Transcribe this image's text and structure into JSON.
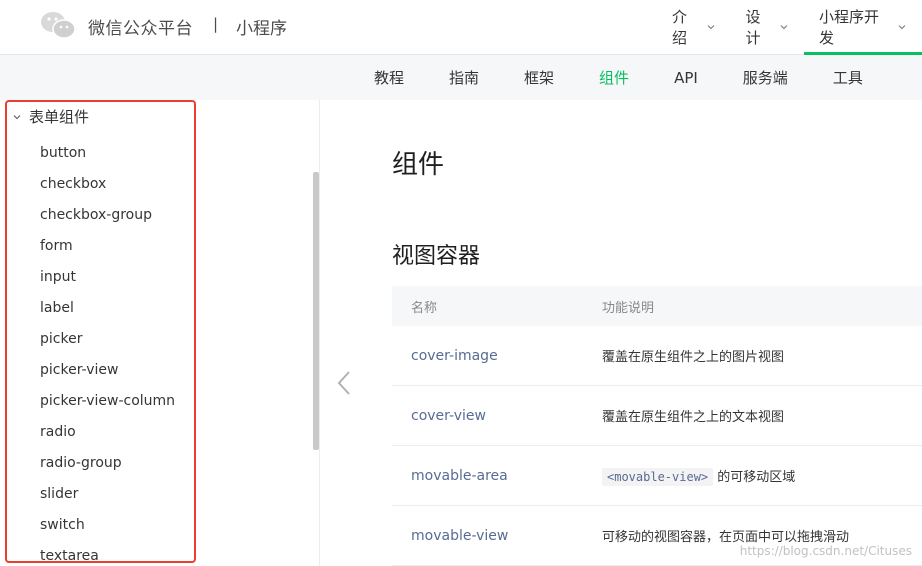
{
  "header": {
    "brand": "微信公众平台",
    "separator": "|",
    "product": "小程序",
    "nav": [
      {
        "label": "介绍",
        "active": false
      },
      {
        "label": "设计",
        "active": false
      },
      {
        "label": "小程序开发",
        "active": true
      }
    ]
  },
  "subnav": [
    {
      "label": "教程",
      "active": false
    },
    {
      "label": "指南",
      "active": false
    },
    {
      "label": "框架",
      "active": false
    },
    {
      "label": "组件",
      "active": true
    },
    {
      "label": "API",
      "active": false
    },
    {
      "label": "服务端",
      "active": false
    },
    {
      "label": "工具",
      "active": false
    }
  ],
  "sidebar": {
    "group_title": "表单组件",
    "items": [
      "button",
      "checkbox",
      "checkbox-group",
      "form",
      "input",
      "label",
      "picker",
      "picker-view",
      "picker-view-column",
      "radio",
      "radio-group",
      "slider",
      "switch",
      "textarea"
    ]
  },
  "main": {
    "title": "组件",
    "section_title": "视图容器",
    "table": {
      "headers": [
        "名称",
        "功能说明"
      ],
      "rows": [
        {
          "name": "cover-image",
          "desc": "覆盖在原生组件之上的图片视图"
        },
        {
          "name": "cover-view",
          "desc": "覆盖在原生组件之上的文本视图"
        },
        {
          "name": "movable-area",
          "code": "<movable-view>",
          "desc": " 的可移动区域"
        },
        {
          "name": "movable-view",
          "desc": "可移动的视图容器，在页面中可以拖拽滑动"
        }
      ]
    }
  },
  "watermark": "https://blog.csdn.net/Cituses",
  "colors": {
    "accent": "#07c160",
    "link": "#576b95",
    "highlight": "#ec3e2e"
  }
}
